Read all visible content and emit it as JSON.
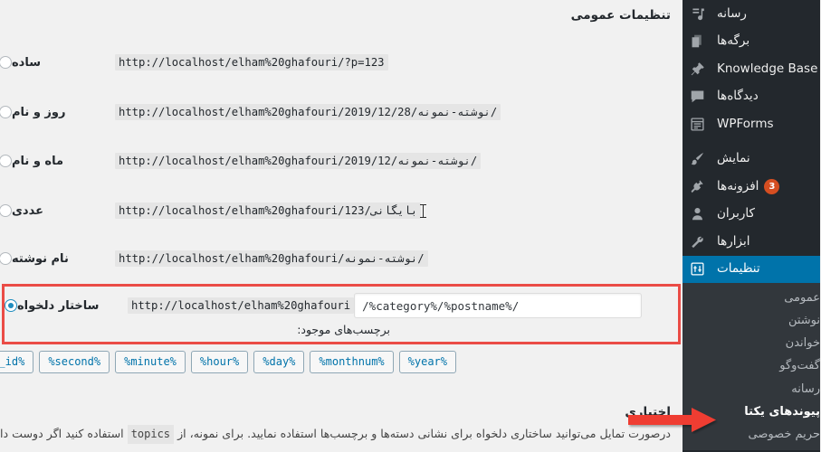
{
  "page": {
    "title": "تنظیمات عمومی",
    "section_heading": "اختیاری",
    "section_paragraph_pre": "درصورت تمایل می‌توانید ساختاری دلخواه برای نشانی دسته‌ها و برچسب‌ها استفاده نمایید. برای نمونه، از",
    "section_paragraph_code": "topics",
    "section_paragraph_post": "استفاده کنید اگر دوست دارید پیوند د"
  },
  "permalink_options": [
    {
      "key": "plain",
      "label": "ساده",
      "url": "http://localhost/elham%20ghafouri/?p=123",
      "selected": false
    },
    {
      "key": "day-and-name",
      "label": "روز و نام",
      "url": "http://localhost/elham%20ghafouri/2019/12/28/نوشته-نمونه/",
      "selected": false
    },
    {
      "key": "month-and-name",
      "label": "ماه و نام",
      "url": "http://localhost/elham%20ghafouri/2019/12/نوشته-نمونه/",
      "selected": false
    },
    {
      "key": "numeric",
      "label": "عددی",
      "url": "http://localhost/elham%20ghafouri/بایگانی/123",
      "selected": false
    },
    {
      "key": "post-name",
      "label": "نام نوشته",
      "url": "http://localhost/elham%20ghafouri/نوشته-نمونه/",
      "selected": false
    }
  ],
  "custom_structure": {
    "label": "ساختار دلخواه",
    "selected": true,
    "prefix_url": "http://localhost/elham%20ghafouri",
    "input_value": "/%category%/%postname%/",
    "available_tags_label": "برچسب‌های موجود:",
    "tags": [
      "%post_id%",
      "%second%",
      "%minute%",
      "%hour%",
      "%day%",
      "%monthnum%",
      "%year%"
    ]
  },
  "sidebar": {
    "menu": [
      {
        "key": "media",
        "label": "رسانه",
        "icon": "media-icon",
        "current": false
      },
      {
        "key": "pages",
        "label": "برگه‌ها",
        "icon": "pages-icon",
        "current": false
      },
      {
        "key": "knowledge-base",
        "label": "Knowledge Base",
        "icon": "pin-icon",
        "current": false
      },
      {
        "key": "comments",
        "label": "دیدگاه‌ها",
        "icon": "comment-icon",
        "current": false
      },
      {
        "key": "wpforms",
        "label": "WPForms",
        "icon": "form-icon",
        "current": false
      },
      {
        "key": "appearance",
        "label": "نمایش",
        "icon": "brush-icon",
        "current": false
      },
      {
        "key": "plugins",
        "label": "افزونه‌ها",
        "icon": "plugin-icon",
        "current": false,
        "badge": "3"
      },
      {
        "key": "users",
        "label": "کاربران",
        "icon": "user-icon",
        "current": false
      },
      {
        "key": "tools",
        "label": "ابزارها",
        "icon": "wrench-icon",
        "current": false
      },
      {
        "key": "settings",
        "label": "تنظیمات",
        "icon": "settings-icon",
        "current": true
      }
    ],
    "submenu": [
      {
        "key": "general",
        "label": "عمومی",
        "current": false
      },
      {
        "key": "writing",
        "label": "نوشتن",
        "current": false
      },
      {
        "key": "reading",
        "label": "خواندن",
        "current": false
      },
      {
        "key": "discussion",
        "label": "گفت‌وگو",
        "current": false
      },
      {
        "key": "media",
        "label": "رسانه",
        "current": false
      },
      {
        "key": "permalinks",
        "label": "پیوندهای یکتا",
        "current": true
      },
      {
        "key": "privacy",
        "label": "حریم خصوصی",
        "current": false
      }
    ]
  },
  "annotations": {
    "highlight_color": "#ea4c46",
    "arrow_color": "#ef3d33",
    "accent_color": "#0073aa",
    "sidebar_bg": "#23282d",
    "submenu_bg": "#32373c",
    "badge_color": "#d54e21"
  }
}
